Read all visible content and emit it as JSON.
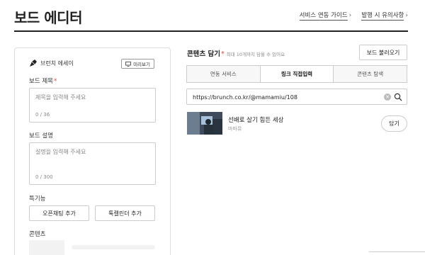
{
  "page": {
    "title": "보드 에디터",
    "links": [
      {
        "label": "서비스 연동 가이드"
      },
      {
        "label": "발행 시 유의사항"
      }
    ]
  },
  "editor": {
    "brand": "브런치 에세이",
    "preview_label": "미리보기",
    "title_label": "보드 제목",
    "title_placeholder": "제목을 입력해 주세요",
    "title_count": "0 / 36",
    "desc_label": "보드 설명",
    "desc_placeholder": "설명을 입력해 주세요",
    "desc_count": "0 / 300",
    "features_label": "특기능",
    "feature_buttons": [
      "오픈채팅 추가",
      "톡캘린더 추가"
    ],
    "content_label": "콘텐츠"
  },
  "content_picker": {
    "title": "콘텐츠 담기",
    "hint": "최대 10개까지 담을 수 있어요",
    "load_button": "보드 불러오기",
    "tabs": [
      {
        "label": "연동 서비스",
        "active": false
      },
      {
        "label": "링크 직접입력",
        "active": true
      },
      {
        "label": "콘텐츠 탐색",
        "active": false
      }
    ],
    "url_value": "https://brunch.co.kr/@mamamiu/108",
    "result": {
      "title": "선배로 살기 힘든 세상",
      "author": "마마뮤",
      "add_label": "담기"
    }
  },
  "icons": {
    "brand": "pen-nib-icon",
    "preview": "monitor-icon",
    "clear": "clear-icon",
    "search": "search-icon",
    "link_chevron": "chevron-right-icon"
  },
  "colors": {
    "required": "#e04a3a",
    "text": "#222222",
    "border": "#cccccc"
  }
}
